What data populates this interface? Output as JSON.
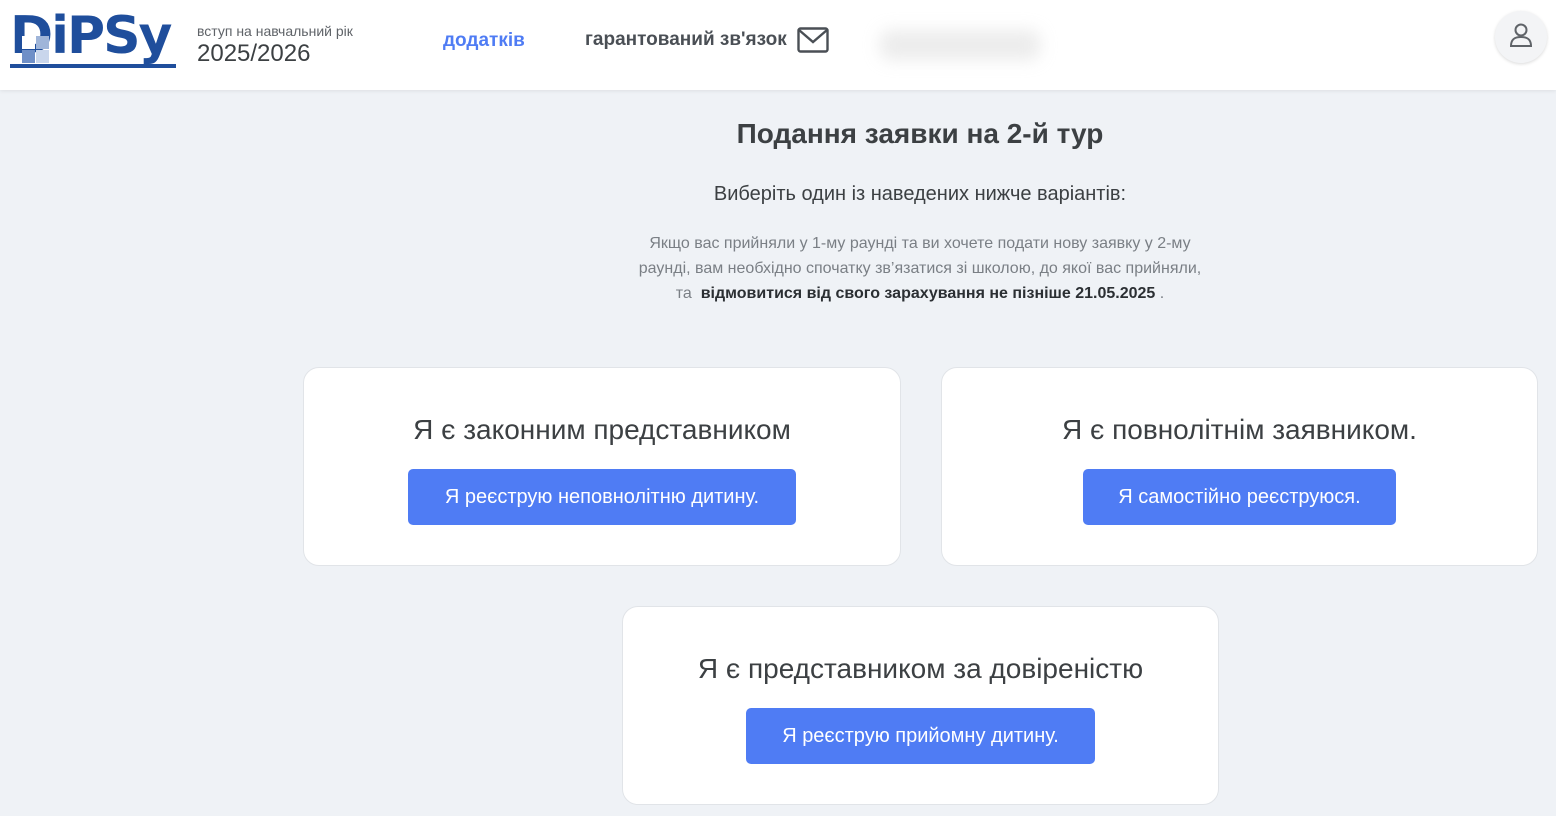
{
  "header": {
    "logo_text": "DiPSy",
    "year_label": "вступ на навчальний рік",
    "year_value": "2025/2026",
    "nav_link": "додатків",
    "contact_label": "гарантований зв'язок",
    "icons": {
      "contact": "mail-icon",
      "profile": "user-icon"
    },
    "colors": {
      "brand": "#1f4e9c",
      "link": "#4f7cf4"
    }
  },
  "main": {
    "title": "Подання заявки на 2-й тур",
    "subtitle": "Виберіть один із наведених нижче варіантів:",
    "note_line1": "Якщо вас прийняли у 1-му раунді та ви хочете подати нову заявку у 2-му",
    "note_line2": "раунді, вам необхідно спочатку зв’язатися зі школою, до якої вас прийняли,",
    "note_prefix": "та",
    "note_bold": "відмовитися від свого зарахування не пізніше 21.05.2025",
    "note_suffix": "."
  },
  "cards": [
    {
      "title": "Я є законним представником",
      "button": "Я реєструю неповнолітню дитину."
    },
    {
      "title": "Я є повнолітнім заявником.",
      "button": "Я самостійно реєструюся."
    },
    {
      "title": "Я є представником за довіреністю",
      "button": "Я реєструю прийомну дитину."
    }
  ],
  "colors": {
    "button": "#4f7cf4",
    "background": "#eff2f6"
  }
}
